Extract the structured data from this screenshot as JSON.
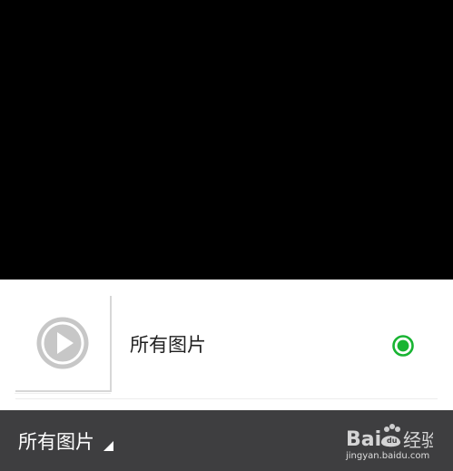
{
  "album_picker": {
    "selected_album": "所有图片",
    "albums": [
      {
        "label": "所有图片",
        "thumbnail_icon": "play-icon",
        "selected": true
      }
    ]
  },
  "bottom_bar": {
    "album_switch_label": "所有图片",
    "caret_icon": "triangle-corner-icon"
  },
  "watermark": {
    "logo_text": "Bai经验",
    "sub_text": "jingyan.baidu.com"
  },
  "colors": {
    "preview_background": "#000000",
    "sheet_background": "#ffffff",
    "bottom_bar_background": "#3e3e40",
    "selected_radio": "#18b432",
    "thumbnail_play": "#c7c7c7"
  }
}
